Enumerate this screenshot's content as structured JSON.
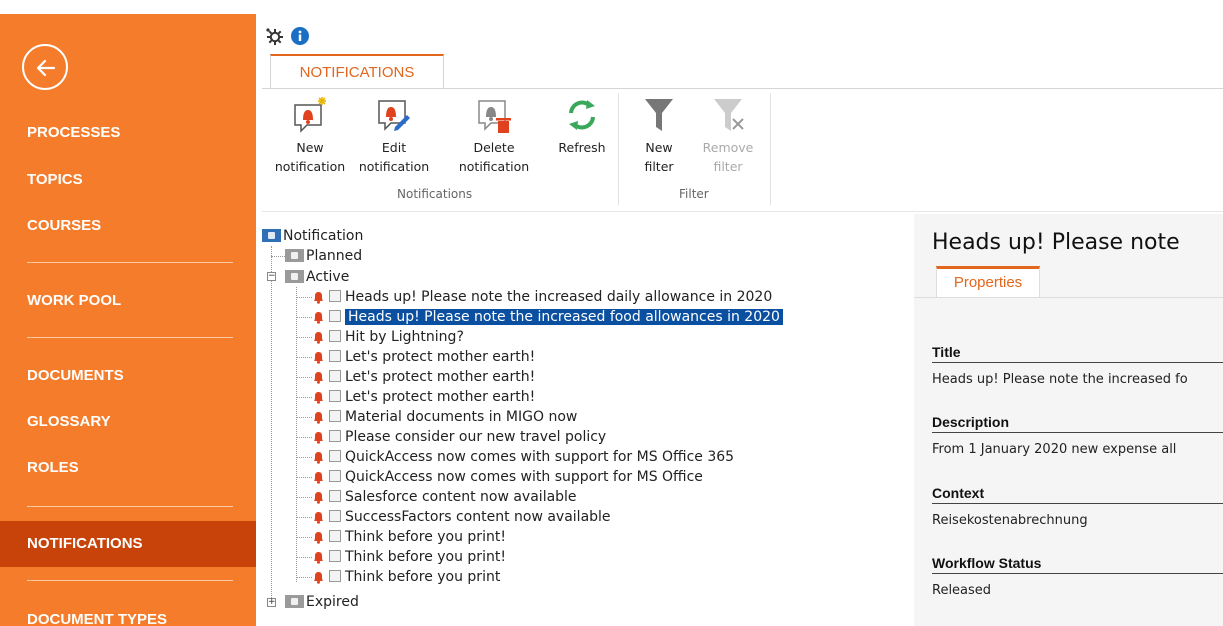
{
  "sidebar": {
    "items": [
      {
        "label": "PROCESSES"
      },
      {
        "label": "TOPICS"
      },
      {
        "label": "COURSES"
      },
      {
        "label": "WORK POOL"
      },
      {
        "label": "DOCUMENTS"
      },
      {
        "label": "GLOSSARY"
      },
      {
        "label": "ROLES"
      },
      {
        "label": "NOTIFICATIONS",
        "active": true
      },
      {
        "label": "DOCUMENT TYPES"
      }
    ]
  },
  "top_icons": [
    "gear-icon",
    "info-icon"
  ],
  "tab": {
    "label": "NOTIFICATIONS"
  },
  "ribbon": {
    "groups": [
      {
        "label": "Notifications",
        "buttons": [
          {
            "line1": "New",
            "line2": "notification",
            "icon": "new-notification-icon"
          },
          {
            "line1": "Edit",
            "line2": "notification",
            "icon": "edit-notification-icon"
          },
          {
            "line1": "Delete",
            "line2": "notification",
            "icon": "delete-notification-icon"
          },
          {
            "line1": "Refresh",
            "line2": "",
            "icon": "refresh-icon"
          }
        ]
      },
      {
        "label": "Filter",
        "buttons": [
          {
            "line1": "New",
            "line2": "filter",
            "icon": "filter-icon"
          },
          {
            "line1": "Remove",
            "line2": "filter",
            "icon": "remove-filter-icon",
            "disabled": true
          }
        ]
      }
    ]
  },
  "tree": {
    "root": "Notification",
    "planned": "Planned",
    "active": "Active",
    "expired": "Expired",
    "active_items": [
      "Heads up! Please note the increased daily allowance in 2020",
      "Heads up! Please note the increased food allowances in 2020",
      "Hit by Lightning?",
      "Let's protect mother earth!",
      "Let's protect mother earth!",
      "Let's protect mother earth!",
      "Material documents in MIGO now",
      "Please consider our new travel policy",
      "QuickAccess now comes with support for MS Office 365",
      "QuickAccess now comes with support for MS Office",
      "Salesforce content now available",
      "SuccessFactors content now available",
      "Think before you print!",
      "Think before you print!",
      "Think before you print"
    ],
    "selected_index": 1
  },
  "detail": {
    "title": "Heads up! Please note",
    "tab": "Properties",
    "properties": [
      {
        "label": "Title",
        "value": "Heads up! Please note the increased fo"
      },
      {
        "label": "Description",
        "value": "From 1 January 2020 new expense all"
      },
      {
        "label": "Context",
        "value": "Reisekostenabrechnung"
      },
      {
        "label": "Workflow Status",
        "value": "Released"
      }
    ]
  },
  "colors": {
    "sidebar": "#f47c2a",
    "sidebar_active": "#c8430a",
    "accent": "#e2661e",
    "selection": "#0a4fa0"
  }
}
